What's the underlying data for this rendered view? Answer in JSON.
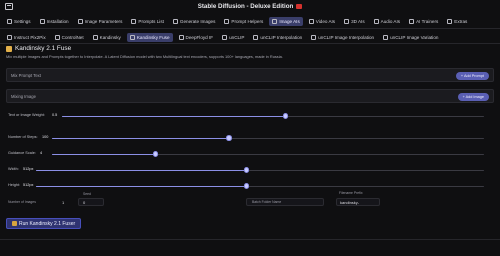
{
  "app": {
    "title": "Stable Diffusion - Deluxe Edition"
  },
  "nav": {
    "row1": [
      {
        "label": "Settings",
        "icon": "gear-icon",
        "active": false
      },
      {
        "label": "Installation",
        "icon": "box-icon",
        "active": false
      },
      {
        "label": "Image Parameters",
        "icon": "image-icon",
        "active": false
      },
      {
        "label": "Prompts List",
        "icon": "list-icon",
        "active": false
      },
      {
        "label": "Generate Images",
        "icon": "image-icon",
        "active": false
      },
      {
        "label": "Prompt Helpers",
        "icon": "bulb-icon",
        "active": false
      },
      {
        "label": "Image AIs",
        "icon": "image-icon",
        "active": true
      },
      {
        "label": "Video AIs",
        "icon": "video-icon",
        "active": false
      },
      {
        "label": "3D AIs",
        "icon": "cube-icon",
        "active": false
      },
      {
        "label": "Audio AIs",
        "icon": "audio-icon",
        "active": false
      },
      {
        "label": "AI Trainers",
        "icon": "trainer-icon",
        "active": false
      },
      {
        "label": "Extras",
        "icon": "extras-icon",
        "active": false
      }
    ],
    "row2": [
      {
        "label": "Instruct Pix2Pix",
        "icon": "pix2pix-icon",
        "active": false
      },
      {
        "label": "ControlNet",
        "icon": "controlnet-icon",
        "active": false
      },
      {
        "label": "Kandinsky",
        "icon": "kandinsky-icon",
        "active": false
      },
      {
        "label": "Kandinsky Fuse",
        "icon": "fuse-icon",
        "active": true
      },
      {
        "label": "DeepFloyd IF",
        "icon": "deepfloyd-icon",
        "active": false
      },
      {
        "label": "unCLIP",
        "icon": "unclip-icon",
        "active": false
      },
      {
        "label": "unCLIP Interpolation",
        "icon": "unclip-icon",
        "active": false
      },
      {
        "label": "unCLIP Image Interpolation",
        "icon": "unclip-icon",
        "active": false
      },
      {
        "label": "unCLIP Image Variation",
        "icon": "unclip-icon",
        "active": false
      }
    ]
  },
  "panel": {
    "title": "Kandinsky 2.1 Fuse",
    "subtitle": "Mix multiple Images and Prompts together to Interpolate. A Latent Diffusion model with two Multilingual text encoders, supports 100+ languages, made in Russia."
  },
  "mix_prompt": {
    "label": "Mix Prompt Text",
    "button": "+ Add Prompt"
  },
  "mixing_image": {
    "label": "Mixing Image",
    "button": "+ Add Image"
  },
  "sliders": [
    {
      "label": "Text or Image Weight:",
      "value": "0.5",
      "fraction": 0.53
    },
    {
      "label": "Number of Steps:",
      "value": "100",
      "fraction": 0.41
    },
    {
      "label": "Guidance Scale:",
      "value": "4",
      "fraction": 0.24
    },
    {
      "label": "Width:",
      "value": "512px",
      "fraction": 0.47
    },
    {
      "label": "Height:",
      "value": "512px",
      "fraction": 0.47
    }
  ],
  "bottom": {
    "num_images_label": "Number of Images",
    "num_images_value": "1",
    "seed_label": "Seed",
    "seed_value": "0",
    "batch_folder_label": "Batch Folder Name",
    "filename_prefix_label": "Filename Prefix",
    "filename_prefix_value": "kandinsky-"
  },
  "run_button": {
    "label": "Run Kandinsky 2.1 Fuser"
  },
  "colors": {
    "accent": "#8b8fe6",
    "active_tab": "#3a3e6a",
    "button": "#5a5fb4"
  }
}
